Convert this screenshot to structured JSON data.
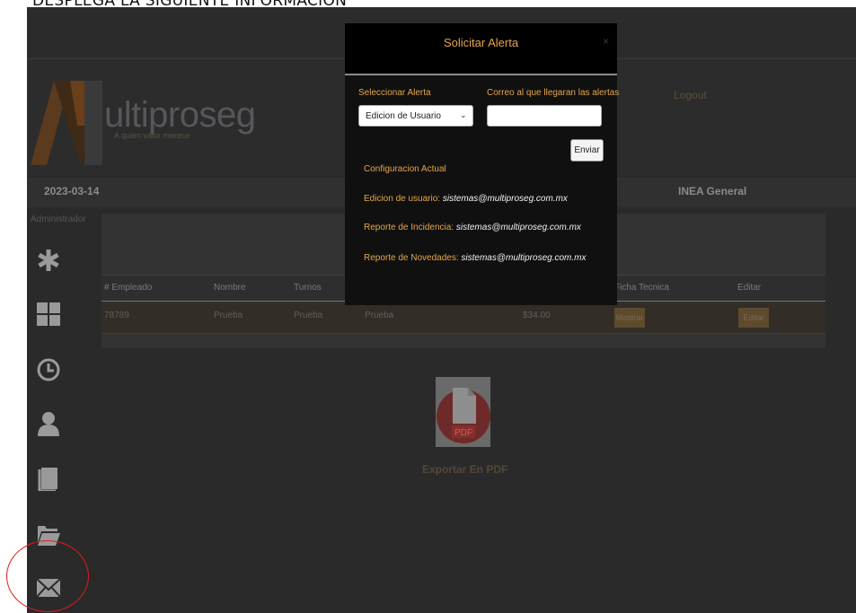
{
  "caption": "DESPLEGA LA SIGUIENTE INFORMACION",
  "header": {
    "logo_text": "ultiproseg",
    "tagline": "A quien valor merece",
    "logout": "Logout",
    "date": "2023-03-14",
    "company": "INEA General"
  },
  "sidebar": {
    "role": "Administrador",
    "icons": [
      "asterisk-icon",
      "grid-icon",
      "clock-icon",
      "user-icon",
      "book-icon",
      "folder-icon",
      "mail-icon"
    ]
  },
  "table": {
    "headers": [
      "# Empleado",
      "Nombre",
      "Turnos",
      "Ficha Tecnica",
      "Editar"
    ],
    "row": {
      "empleado": "78789",
      "nombre": "Prueba",
      "turnos": "Prueba",
      "extra": "Prueba",
      "monto": "$34.00",
      "ficha_btn": "Mostrar",
      "editar_btn": "Editar"
    }
  },
  "export": {
    "label": "Exportar En PDF",
    "pdf_badge": "PDF"
  },
  "modal": {
    "title": "Solicitar Alerta",
    "close": "×",
    "select_label": "Seleccionar Alerta",
    "select_value": "Edicion de Usuario",
    "email_label": "Correo al que llegaran las alertas",
    "email_value": "",
    "send": "Enviar",
    "config_title": "Configuracion Actual",
    "config": [
      {
        "key": "Edicion de usuario:",
        "value": "sistemas@multiproseg.com.mx"
      },
      {
        "key": "Reporte de Incidencia:",
        "value": "sistemas@multiproseg.com.mx"
      },
      {
        "key": "Reporte de Novedades:",
        "value": "sistemas@multiproseg.com.mx"
      }
    ]
  },
  "colors": {
    "accent": "#e6a64a",
    "highlight_circle": "#e0191b",
    "background": "#2a2a2a"
  }
}
